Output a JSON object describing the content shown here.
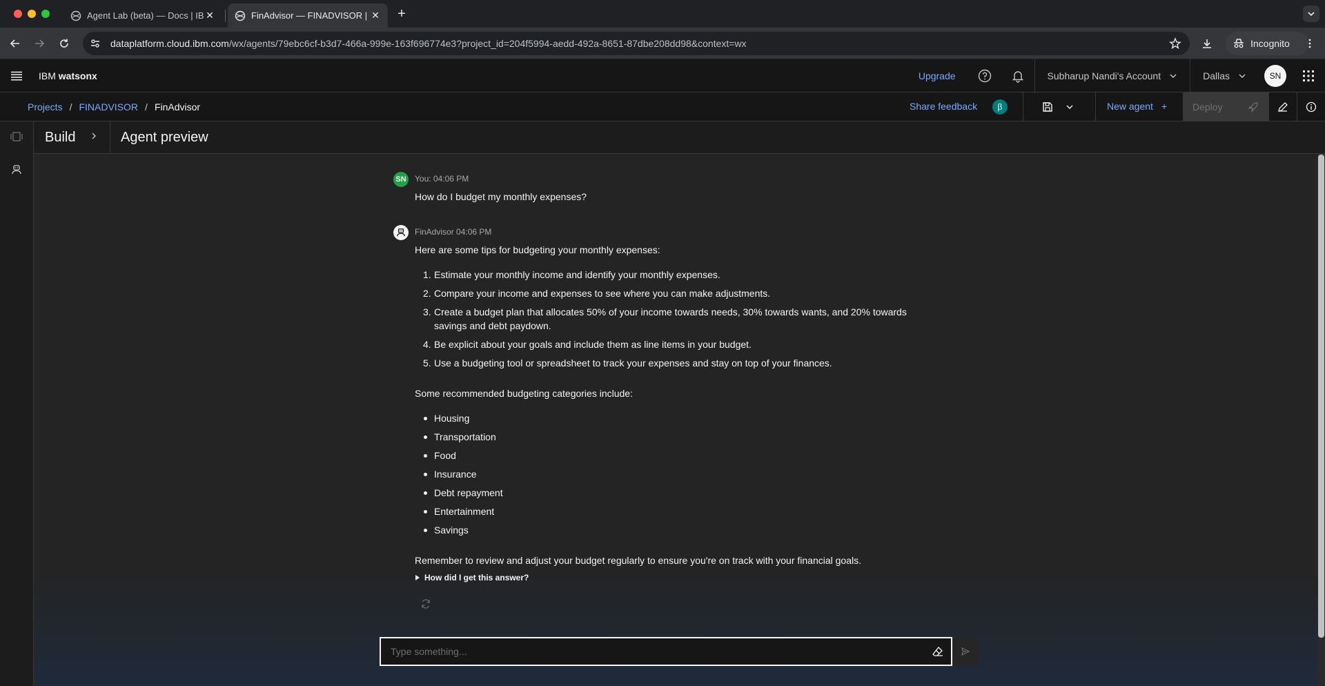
{
  "browser": {
    "tabs": [
      {
        "title": "Agent Lab (beta) — Docs | IBM",
        "active": false
      },
      {
        "title": "FinAdvisor — FINADVISOR | IBM",
        "active": true
      }
    ],
    "url_host": "dataplatform.cloud.ibm.com",
    "url_path": "/wx/agents/79ebc6cf-b3d7-466a-999e-163f696774e3?project_id=204f5994-aedd-492a-8651-87dbe208dd98&context=wx",
    "incognito_label": "Incognito"
  },
  "header": {
    "brand_prefix": "IBM",
    "brand_name": "watsonx",
    "upgrade_label": "Upgrade",
    "account_label": "Subharup Nandi's Account",
    "region_label": "Dallas",
    "user_initials": "SN"
  },
  "breadcrumb": {
    "projects": "Projects",
    "project": "FINADVISOR",
    "current": "FinAdvisor",
    "separator": "/"
  },
  "actions": {
    "share_feedback": "Share feedback",
    "beta_badge": "β",
    "new_agent": "New agent",
    "new_agent_plus": "+",
    "deploy": "Deploy"
  },
  "panel": {
    "build_label": "Build",
    "title": "Agent preview"
  },
  "chat": {
    "user_avatar": "SN",
    "user_meta": "You: 04:06 PM",
    "user_message": "How do I budget my monthly expenses?",
    "bot_meta": "FinAdvisor 04:06 PM",
    "bot_intro": "Here are some tips for budgeting your monthly expenses:",
    "tips": [
      {
        "num": "1.",
        "text": "Estimate your monthly income and identify your monthly expenses."
      },
      {
        "num": "2.",
        "text": "Compare your income and expenses to see where you can make adjustments."
      },
      {
        "num": "3.",
        "text": "Create a budget plan that allocates 50% of your income towards needs, 30% towards wants, and 20% towards savings and debt paydown."
      },
      {
        "num": "4.",
        "text": "Be explicit about your goals and include them as line items in your budget."
      },
      {
        "num": "5.",
        "text": "Use a budgeting tool or spreadsheet to track your expenses and stay on top of your finances."
      }
    ],
    "categories_intro": "Some recommended budgeting categories include:",
    "categories": [
      "Housing",
      "Transportation",
      "Food",
      "Insurance",
      "Debt repayment",
      "Entertainment",
      "Savings"
    ],
    "closing": "Remember to review and adjust your budget regularly to ensure you're on track with your financial goals.",
    "how_label": "How did I get this answer?",
    "input_placeholder": "Type something..."
  },
  "icons": {
    "reload": "reload-icon",
    "back": "back-arrow-icon",
    "forward": "forward-arrow-icon",
    "site_info": "site-info-icon",
    "bookmark": "star-icon",
    "download": "download-icon",
    "menu": "more-vertical-icon",
    "hamburger": "hamburger-menu-icon",
    "help": "help-icon",
    "notification": "bell-icon",
    "apps": "app-switcher-icon",
    "save": "save-icon",
    "edit": "pencil-icon",
    "info": "info-icon",
    "rocket": "rocket-icon",
    "regenerate": "regenerate-icon",
    "eraser": "eraser-icon",
    "send": "send-icon"
  },
  "colors": {
    "link": "#78a9ff",
    "user_avatar": "#24a148",
    "beta_badge": "#007d79",
    "background": "#161616",
    "chat_background": "#242424"
  }
}
